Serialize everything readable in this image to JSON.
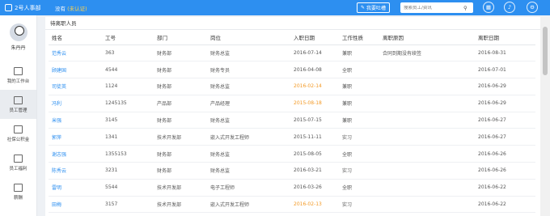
{
  "app": {
    "name": "2号人事部",
    "company": "没有",
    "company_status": "(未认证)"
  },
  "topbar": {
    "feedback_label": "我要吐槽",
    "search_placeholder": "搜索员工/资讯"
  },
  "user": {
    "name": "朱丹丹"
  },
  "sidebar": {
    "items": [
      {
        "label": "我的工作台",
        "icon": "monitor-icon"
      },
      {
        "label": "员工管理",
        "icon": "employee-icon"
      },
      {
        "label": "社保公积金",
        "icon": "house-icon"
      },
      {
        "label": "员工福利",
        "icon": "gift-icon"
      },
      {
        "label": "薪酬",
        "icon": "wallet-icon"
      }
    ]
  },
  "panel": {
    "title": "待离职人员"
  },
  "table": {
    "columns": [
      "姓名",
      "工号",
      "部门",
      "岗位",
      "入职日期",
      "工作性质",
      "离职原因",
      "离职日期"
    ],
    "rows": [
      [
        "范秀云",
        "363",
        "财务部",
        "财务总监",
        "2016-07-14",
        "兼职",
        "合同到期没有续签",
        "2016-08-31"
      ],
      [
        "顾建国",
        "4544",
        "财务部",
        "财务专员",
        "2016-04-08",
        "全职",
        "",
        "2016-07-01"
      ],
      [
        "司徒英",
        "1124",
        "财务部",
        "财务总监",
        "2016-02-14",
        "兼职",
        "",
        "2016-06-29"
      ],
      [
        "冯利",
        "1245135",
        "产品部",
        "产品经理",
        "2015-08-18",
        "兼职",
        "",
        "2016-06-29"
      ],
      [
        "米强",
        "3145",
        "财务部",
        "财务总监",
        "2015-07-15",
        "兼职",
        "",
        "2016-06-27"
      ],
      [
        "郭萍",
        "1341",
        "技术开发部",
        "嵌入式开发工程师",
        "2015-11-11",
        "实习",
        "",
        "2016-06-27"
      ],
      [
        "谢志强",
        "1355153",
        "财务部",
        "财务总监",
        "2015-08-05",
        "全职",
        "",
        "2016-06-26"
      ],
      [
        "陈秀云",
        "3231",
        "财务部",
        "财务总监",
        "2016-03-21",
        "实习",
        "",
        "2016-06-26"
      ],
      [
        "雷明",
        "5544",
        "技术开发部",
        "电子工程师",
        "2016-03-26",
        "全职",
        "",
        "2016-06-22"
      ],
      [
        "田梅",
        "3157",
        "技术开发部",
        "嵌入式开发工程师",
        "2016-02-13",
        "实习",
        "",
        "2016-06-22"
      ]
    ],
    "highlight_color": "#f39a26",
    "link_color": "#2d8ff0"
  }
}
